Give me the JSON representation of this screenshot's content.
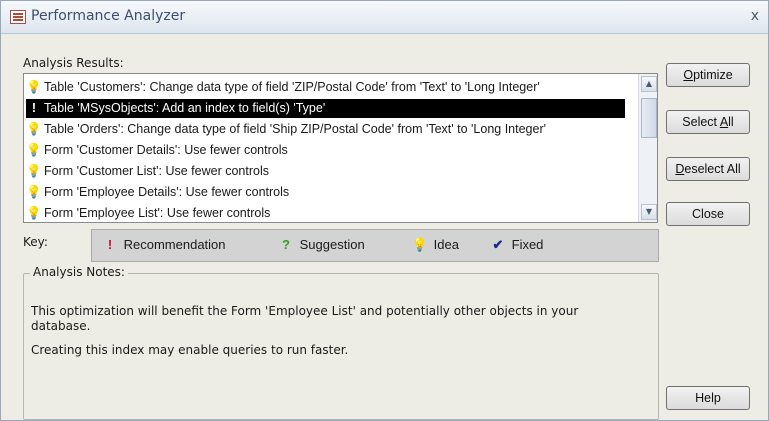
{
  "window": {
    "title": "Performance Analyzer",
    "close_glyph": "x",
    "app_icon": "table-icon"
  },
  "results": {
    "label": "Analysis Results:",
    "items": [
      {
        "icon": "idea",
        "text": "Table 'Customers': Change data type of field 'ZIP/Postal Code' from 'Text' to 'Long Integer'",
        "selected": false
      },
      {
        "icon": "recommendation",
        "text": "Table 'MSysObjects': Add an index to field(s) 'Type'",
        "selected": true
      },
      {
        "icon": "idea",
        "text": "Table 'Orders': Change data type of field 'Ship ZIP/Postal Code' from 'Text' to 'Long Integer'",
        "selected": false
      },
      {
        "icon": "idea",
        "text": "Form 'Customer Details': Use fewer controls",
        "selected": false
      },
      {
        "icon": "idea",
        "text": "Form 'Customer List': Use fewer controls",
        "selected": false
      },
      {
        "icon": "idea",
        "text": "Form 'Employee Details': Use fewer controls",
        "selected": false
      },
      {
        "icon": "idea",
        "text": "Form 'Employee List': Use fewer controls",
        "selected": false
      }
    ]
  },
  "key": {
    "label": "Key:",
    "items": [
      {
        "icon": "recommendation",
        "label": "Recommendation",
        "color": "#c8102e"
      },
      {
        "icon": "suggestion",
        "label": "Suggestion",
        "color": "#3a9a2a"
      },
      {
        "icon": "idea",
        "label": "Idea",
        "color": "#d4a017"
      },
      {
        "icon": "fixed",
        "label": "Fixed",
        "color": "#1a2a8a"
      }
    ]
  },
  "notes": {
    "legend": "Analysis Notes:",
    "paragraph1": "This optimization will benefit the Form 'Employee List' and potentially other objects in your database.",
    "paragraph2": "Creating this index may enable queries to run faster."
  },
  "buttons": {
    "optimize": {
      "mnemonic": "O",
      "rest": "ptimize"
    },
    "select_all": {
      "prefix": "Select ",
      "mnemonic": "A",
      "rest": "ll"
    },
    "deselect_all": {
      "mnemonic": "D",
      "rest": "eselect All"
    },
    "close": {
      "label": "Close"
    },
    "help": {
      "label": "Help"
    }
  },
  "colors": {
    "selection_bg": "#000000",
    "idea_icon": "#d4a017",
    "recommendation_icon": "#c8102e"
  }
}
